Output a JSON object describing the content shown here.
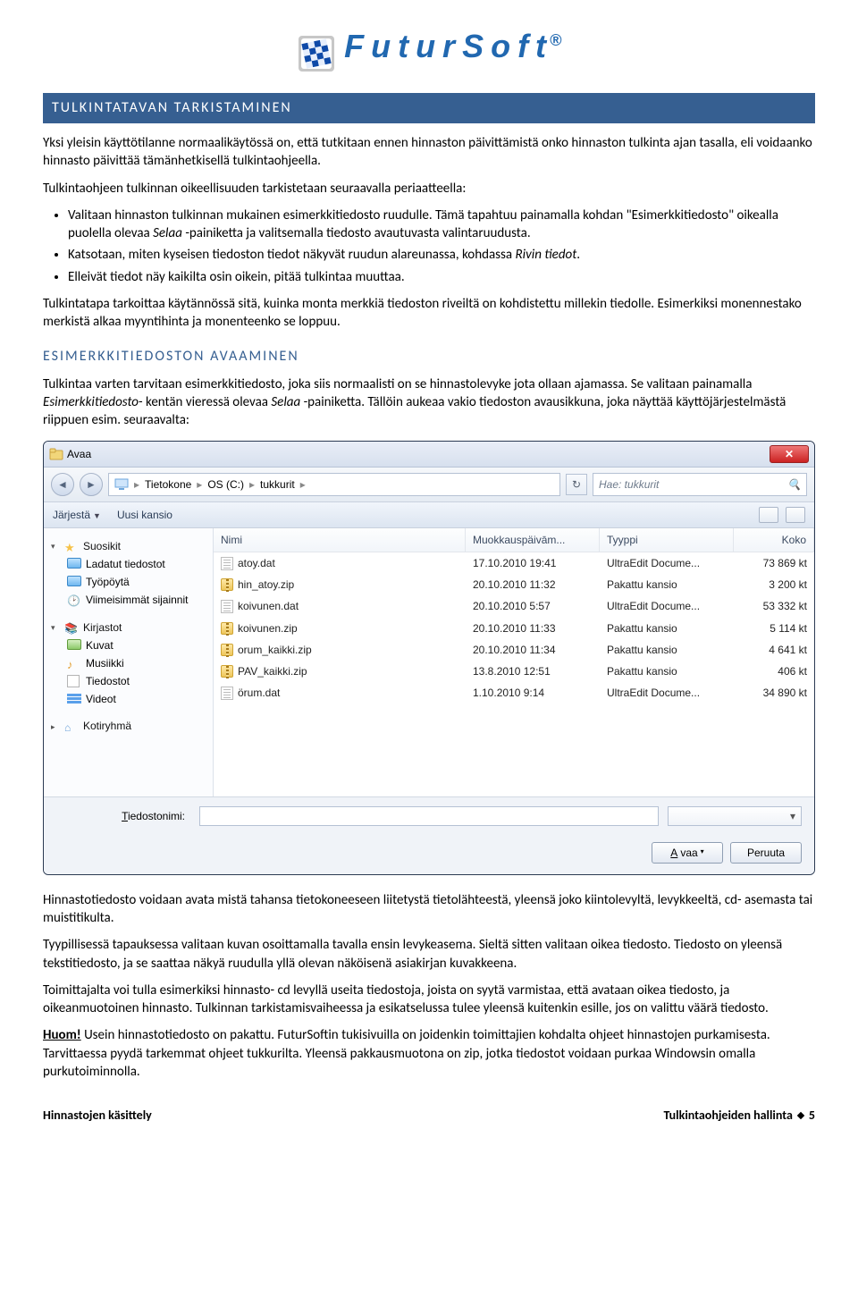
{
  "logo": {
    "brand": "FuturSoft",
    "reg": "®"
  },
  "sections": {
    "h_tark": "TULKINTATAVAN TARKISTAMINEN",
    "p1": "Yksi yleisin käyttötilanne normaalikäytössä on, että tutkitaan ennen hinnaston päivittämistä onko hinnaston tulkinta ajan tasalla, eli voidaanko hinnasto päivittää tämänhetkisellä tulkintaohjeella.",
    "p2_intro": "Tulkintaohjeen tulkinnan oikeellisuuden tarkistetaan seuraavalla periaatteella:",
    "b1a": "Valitaan hinnaston tulkinnan mukainen esimerkkitiedosto ruudulle. Tämä tapahtuu painamalla kohdan \"Esimerkkitiedosto\" oikealla puolella olevaa ",
    "b1b": " -painiketta ja valitsemalla tiedosto avautuvasta valintaruudusta.",
    "b1_em": "Selaa",
    "b2a": "Katsotaan, miten kyseisen tiedoston tiedot näkyvät ruudun alareunassa, kohdassa ",
    "b2_em": "Rivin tiedot",
    "b2b": ".",
    "b3": "Elleivät tiedot näy kaikilta osin oikein, pitää tulkintaa muuttaa.",
    "p3": "Tulkintatapa tarkoittaa käytännössä sitä, kuinka monta merkkiä tiedoston riveiltä on kohdistettu millekin tiedolle. Esimerkiksi monennestako merkistä alkaa myyntihinta ja monenteenko se loppuu.",
    "h_avaa": "ESIMERKKITIEDOSTON AVAAMINEN",
    "p4a": "Tulkintaa varten tarvitaan esimerkkitiedosto, joka siis normaalisti on se hinnastolevyke jota ollaan ajamassa. Se valitaan painamalla ",
    "p4_em1": "Esimerkkitiedosto",
    "p4b": "- kentän vieressä olevaa ",
    "p4_em2": "Selaa",
    "p4c": " -painiketta. Tällöin aukeaa vakio tiedoston avausikkuna, joka näyttää käyttöjärjestelmästä riippuen esim. seuraavalta:",
    "p5": "Hinnastotiedosto voidaan avata mistä tahansa tietokoneeseen liitetystä tietolähteestä, yleensä joko kiintolevyltä, levykkeeltä, cd- asemasta tai muistitikulta.",
    "p6": "Tyypillisessä tapauksessa valitaan kuvan osoittamalla tavalla ensin levykeasema. Sieltä sitten valitaan oikea tiedosto. Tiedosto on yleensä tekstitiedosto, ja se saattaa näkyä ruudulla yllä olevan näköisenä asiakirjan kuvakkeena.",
    "p7": "Toimittajalta voi tulla esimerkiksi hinnasto- cd levyllä useita tiedostoja, joista on syytä varmistaa, että avataan oikea tiedosto, ja oikeanmuotoinen hinnasto. Tulkinnan tarkistamisvaiheessa ja esikatselussa tulee yleensä kuitenkin esille, jos on valittu väärä tiedosto.",
    "p8_b": "Huom!",
    "p8": " Usein hinnastotiedosto on pakattu. FuturSoftin tukisivuilla on joidenkin toimittajien kohdalta ohjeet hinnastojen purkamisesta. Tarvittaessa pyydä tarkemmat ohjeet tukkurilta. Yleensä pakkausmuotona on zip, jotka tiedostot voidaan purkaa Windowsin omalla purkutoiminnolla."
  },
  "dialog": {
    "title": "Avaa",
    "breadcrumb": [
      "Tietokone",
      "OS (C:)",
      "tukkurit"
    ],
    "search_placeholder": "Hae: tukkurit",
    "toolbar": {
      "organize": "Järjestä",
      "newfolder": "Uusi kansio"
    },
    "sidebar": {
      "favorites": "Suosikit",
      "fav_items": [
        "Ladatut tiedostot",
        "Työpöytä",
        "Viimeisimmät sijainnit"
      ],
      "libraries": "Kirjastot",
      "lib_items": [
        "Kuvat",
        "Musiikki",
        "Tiedostot",
        "Videot"
      ],
      "homegroup": "Kotiryhmä"
    },
    "columns": {
      "name": "Nimi",
      "date": "Muokkauspäivām...",
      "type": "Tyyppi",
      "size": "Koko"
    },
    "files": [
      {
        "icon": "txt",
        "name": "atoy.dat",
        "date": "17.10.2010 19:41",
        "type": "UltraEdit Docume...",
        "size": "73 869 kt"
      },
      {
        "icon": "zip",
        "name": "hin_atoy.zip",
        "date": "20.10.2010 11:32",
        "type": "Pakattu kansio",
        "size": "3 200 kt"
      },
      {
        "icon": "txt",
        "name": "koivunen.dat",
        "date": "20.10.2010 5:57",
        "type": "UltraEdit Docume...",
        "size": "53 332 kt"
      },
      {
        "icon": "zip",
        "name": "koivunen.zip",
        "date": "20.10.2010 11:33",
        "type": "Pakattu kansio",
        "size": "5 114 kt"
      },
      {
        "icon": "zip",
        "name": "orum_kaikki.zip",
        "date": "20.10.2010 11:34",
        "type": "Pakattu kansio",
        "size": "4 641 kt"
      },
      {
        "icon": "zip",
        "name": "PAV_kaikki.zip",
        "date": "13.8.2010 12:51",
        "type": "Pakattu kansio",
        "size": "406 kt"
      },
      {
        "icon": "txt",
        "name": "örum.dat",
        "date": "1.10.2010 9:14",
        "type": "UltraEdit Docume...",
        "size": "34 890 kt"
      }
    ],
    "footer": {
      "filename_label": "Tiedostonimi:",
      "open": "Avaa",
      "cancel": "Peruuta"
    }
  },
  "pagefooter": {
    "left": "Hinnastojen käsittely",
    "right": "Tulkintaohjeiden hallinta",
    "page": "5"
  }
}
